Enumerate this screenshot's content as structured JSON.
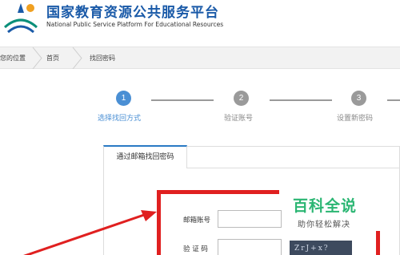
{
  "header": {
    "title": "国家教育资源公共服务平台",
    "subtitle": "National Public  Service Platform For Educational Resources"
  },
  "breadcrumb": {
    "location": "您的位置",
    "home": "首页",
    "current": "找回密码"
  },
  "steps": [
    {
      "number": "1",
      "label": "选择找回方式",
      "active": true
    },
    {
      "number": "2",
      "label": "验证账号",
      "active": false
    },
    {
      "number": "3",
      "label": "设置新密码",
      "active": false
    }
  ],
  "form": {
    "tab_label": "通过邮箱找回密码",
    "email_label": "邮箱账号",
    "email_value": "",
    "captcha_label": "验 证 码",
    "captcha_value": "",
    "captcha_image_text": "ZrJ+x?"
  },
  "watermark": {
    "title": "百科全说",
    "subtitle": "助你轻松解决"
  },
  "colors": {
    "brand": "#1a5aa8",
    "step_active": "#4a8fd4",
    "step_inactive": "#9a9a9a",
    "annotation": "#e02020",
    "watermark": "#2bb673"
  }
}
